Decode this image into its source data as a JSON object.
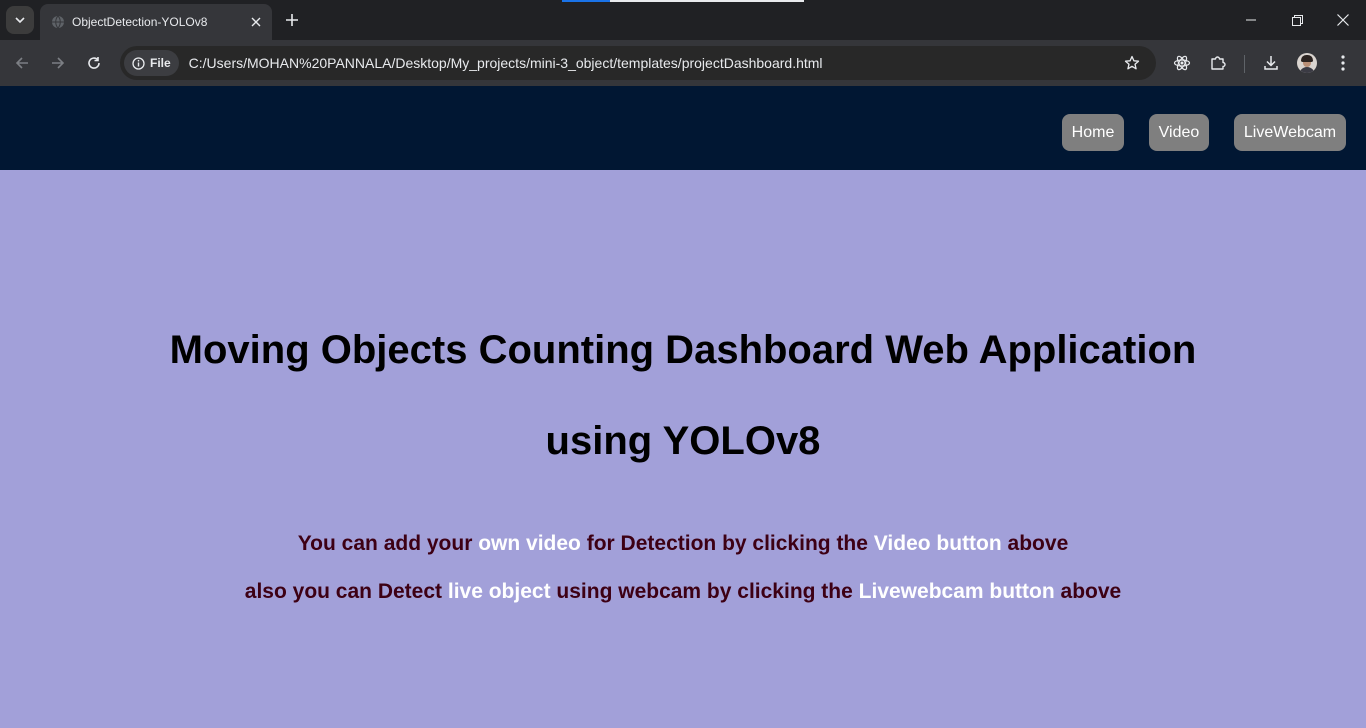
{
  "browser": {
    "tab": {
      "title": "ObjectDetection-YOLOv8",
      "favicon": "globe-icon"
    },
    "address": {
      "chip_label": "File",
      "url": "C:/Users/MOHAN%20PANNALA/Desktop/My_projects/mini-3_object/templates/projectDashboard.html"
    },
    "icons": [
      "tab-search-icon",
      "close-icon",
      "plus-icon",
      "minimize-icon",
      "restore-icon",
      "window-close-icon",
      "back-arrow-icon",
      "forward-arrow-icon",
      "reload-icon",
      "info-icon",
      "star-icon",
      "react-devtools-icon",
      "puzzle-icon",
      "download-icon",
      "kebab-menu-icon"
    ]
  },
  "nav": {
    "home": "Home",
    "video": "Video",
    "livewebcam": "LiveWebcam"
  },
  "hero": {
    "title_line1": "Moving Objects Counting Dashboard Web Application",
    "title_line2": "using YOLOv8"
  },
  "info": {
    "line1": {
      "p1": "You can add your ",
      "h1": "own video",
      "p2": " for Detection by clicking the ",
      "h2": "Video button",
      "p3": " above"
    },
    "line2": {
      "p1": "also you can Detect ",
      "h1": "live object",
      "p2": " using webcam by clicking the ",
      "h2": "Livewebcam button",
      "p3": " above"
    }
  },
  "colors": {
    "page_bg": "#a2a0d9",
    "header_bg": "#011733",
    "nav_button_bg": "#7f7f7f",
    "info_text": "#3d0014",
    "highlight_text": "#ffffff"
  }
}
